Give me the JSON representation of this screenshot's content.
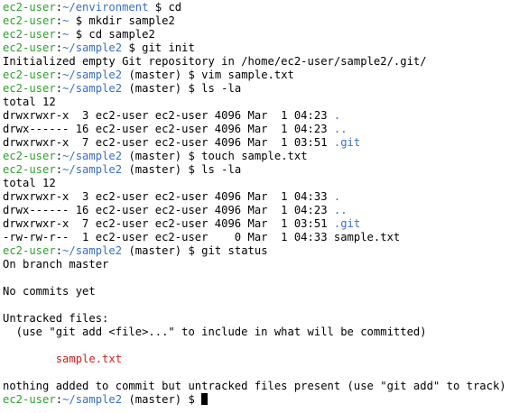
{
  "colors": {
    "user": "#2e9f2e",
    "path": "#3a6fc4",
    "untracked": "#c9221c",
    "background": "#ffffff",
    "text": "#000000"
  },
  "user": "ec2-user",
  "lines": [
    {
      "type": "prompt",
      "path": "~/environment",
      "branch": "",
      "cmd": "cd"
    },
    {
      "type": "prompt",
      "path": "~",
      "branch": "",
      "cmd": "mkdir sample2"
    },
    {
      "type": "prompt",
      "path": "~",
      "branch": "",
      "cmd": "cd sample2"
    },
    {
      "type": "prompt",
      "path": "~/sample2",
      "branch": "",
      "cmd": "git init"
    },
    {
      "type": "text",
      "text": "Initialized empty Git repository in /home/ec2-user/sample2/.git/"
    },
    {
      "type": "prompt",
      "path": "~/sample2",
      "branch": "(master)",
      "cmd": "vim sample.txt"
    },
    {
      "type": "prompt",
      "path": "~/sample2",
      "branch": "(master)",
      "cmd": "ls -la"
    },
    {
      "type": "text",
      "text": "total 12"
    },
    {
      "type": "ls",
      "meta": "drwxrwxr-x  3 ec2-user ec2-user 4096 Mar  1 04:23 ",
      "name": ".",
      "dir": true
    },
    {
      "type": "ls",
      "meta": "drwx------ 16 ec2-user ec2-user 4096 Mar  1 04:23 ",
      "name": "..",
      "dir": true
    },
    {
      "type": "ls",
      "meta": "drwxrwxr-x  7 ec2-user ec2-user 4096 Mar  1 03:51 ",
      "name": ".git",
      "dir": true
    },
    {
      "type": "prompt",
      "path": "~/sample2",
      "branch": "(master)",
      "cmd": "touch sample.txt"
    },
    {
      "type": "prompt",
      "path": "~/sample2",
      "branch": "(master)",
      "cmd": "ls -la"
    },
    {
      "type": "text",
      "text": "total 12"
    },
    {
      "type": "ls",
      "meta": "drwxrwxr-x  3 ec2-user ec2-user 4096 Mar  1 04:33 ",
      "name": ".",
      "dir": true
    },
    {
      "type": "ls",
      "meta": "drwx------ 16 ec2-user ec2-user 4096 Mar  1 04:23 ",
      "name": "..",
      "dir": true
    },
    {
      "type": "ls",
      "meta": "drwxrwxr-x  7 ec2-user ec2-user 4096 Mar  1 03:51 ",
      "name": ".git",
      "dir": true
    },
    {
      "type": "ls",
      "meta": "-rw-rw-r--  1 ec2-user ec2-user    0 Mar  1 04:33 ",
      "name": "sample.txt",
      "dir": false
    },
    {
      "type": "prompt",
      "path": "~/sample2",
      "branch": "(master)",
      "cmd": "git status"
    },
    {
      "type": "text",
      "text": "On branch master"
    },
    {
      "type": "blank"
    },
    {
      "type": "text",
      "text": "No commits yet"
    },
    {
      "type": "blank"
    },
    {
      "type": "text",
      "text": "Untracked files:"
    },
    {
      "type": "text",
      "text": "  (use \"git add <file>...\" to include in what will be committed)"
    },
    {
      "type": "blank"
    },
    {
      "type": "untracked",
      "text": "        sample.txt"
    },
    {
      "type": "blank"
    },
    {
      "type": "text",
      "text": "nothing added to commit but untracked files present (use \"git add\" to track)"
    },
    {
      "type": "prompt",
      "path": "~/sample2",
      "branch": "(master)",
      "cmd": "",
      "cursor": true
    }
  ]
}
